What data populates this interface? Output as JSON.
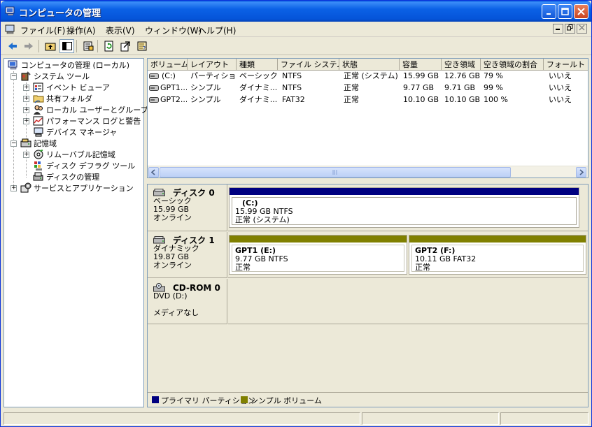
{
  "window": {
    "title": "コンピュータの管理",
    "controls": {
      "minimize": "minimize-button",
      "maximize": "maximize-button",
      "close": "close-button"
    }
  },
  "menubar": {
    "items": [
      {
        "label": "ファイル(F)"
      },
      {
        "label": "操作(A)"
      },
      {
        "label": "表示(V)"
      },
      {
        "label": "ウィンドウ(W)"
      },
      {
        "label": "ヘルプ(H)"
      }
    ]
  },
  "toolbar": {
    "buttons": [
      "back-icon",
      "forward-icon",
      "up-folder-icon",
      "show-tree-icon",
      "properties-icon",
      "refresh-icon",
      "export-icon",
      "help-icon"
    ]
  },
  "tree": {
    "root": "コンピュータの管理 (ローカル)",
    "system_tools": "システム ツール",
    "event_viewer": "イベント ビューア",
    "shared_folders": "共有フォルダ",
    "local_users": "ローカル ユーザーとグループ",
    "perf_logs": "パフォーマンス ログと警告",
    "device_manager": "デバイス マネージャ",
    "storage": "記憶域",
    "removable": "リムーバブル記憶域",
    "defrag": "ディスク デフラグ ツール",
    "disk_mgmt": "ディスクの管理",
    "services_apps": "サービスとアプリケーション"
  },
  "volume_list": {
    "columns": [
      "ボリューム",
      "レイアウト",
      "種類",
      "ファイル システム",
      "状態",
      "容量",
      "空き領域",
      "空き領域の割合",
      "フォールト ト"
    ],
    "rows": [
      [
        "(C:)",
        "パーティション",
        "ベーシック",
        "NTFS",
        "正常 (システム)",
        "15.99 GB",
        "12.76 GB",
        "79 %",
        "いいえ"
      ],
      [
        "GPT1...",
        "シンプル",
        "ダイナミ...",
        "NTFS",
        "正常",
        "9.77 GB",
        "9.71 GB",
        "99 %",
        "いいえ"
      ],
      [
        "GPT2...",
        "シンプル",
        "ダイナミ...",
        "FAT32",
        "正常",
        "10.10 GB",
        "10.10 GB",
        "100 %",
        "いいえ"
      ]
    ]
  },
  "disks": {
    "disk0": {
      "name": "ディスク 0",
      "type": "ベーシック",
      "size": "15.99 GB",
      "status": "オンライン",
      "partition": {
        "name": "(C:)",
        "info": "15.99 GB NTFS",
        "status": "正常 (システム)"
      }
    },
    "disk1": {
      "name": "ディスク 1",
      "type": "ダイナミック",
      "size": "19.87 GB",
      "status": "オンライン",
      "partitions": [
        {
          "name": "GPT1 (E:)",
          "info": "9.77 GB NTFS",
          "status": "正常"
        },
        {
          "name": "GPT2 (F:)",
          "info": "10.11 GB FAT32",
          "status": "正常"
        }
      ]
    },
    "cdrom0": {
      "name": "CD-ROM 0",
      "type": "DVD (D:)",
      "status": "メディアなし"
    }
  },
  "legend": {
    "primary": "プライマリ パーティション",
    "simple": "シンプル ボリューム",
    "primary_color": "#000080",
    "simple_color": "#808000"
  }
}
